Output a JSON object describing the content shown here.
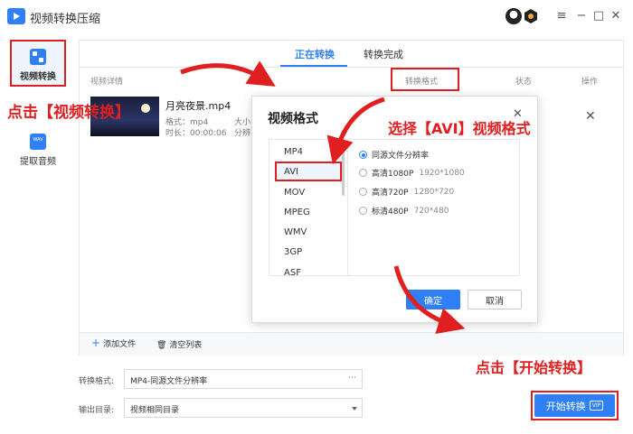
{
  "app": {
    "title": "视频转换压缩"
  },
  "window_controls": {
    "menu": "≡",
    "minimize": "−",
    "maximize": "□",
    "close": "✕"
  },
  "sidebar": {
    "items": [
      {
        "label": "视频转换",
        "icon": "video-convert-icon"
      },
      {
        "label": "提取音频",
        "icon": "extract-audio-icon"
      }
    ]
  },
  "tabs": [
    {
      "label": "正在转换"
    },
    {
      "label": "转换完成"
    }
  ],
  "columns": {
    "details": "视频详情",
    "format": "转换格式",
    "status": "状态",
    "action": "操作"
  },
  "file": {
    "name": "月亮夜景.mp4",
    "format_label": "格式：mp4",
    "duration_label": "时长：00:00:06",
    "size_label": "大小",
    "resolution_label": "分辨"
  },
  "bottom_bar": {
    "add_file": "添加文件",
    "clear_list": "清空列表"
  },
  "settings": {
    "format_label": "转换格式:",
    "format_value": "MP4-同源文件分辨率",
    "output_label": "输出目录:",
    "output_value": "视频相同目录"
  },
  "start_button": {
    "label": "开始转换",
    "badge": "VIP"
  },
  "dialog": {
    "title": "视频格式",
    "formats": [
      "MP4",
      "AVI",
      "MOV",
      "MPEG",
      "WMV",
      "3GP",
      "ASF"
    ],
    "selected_format": "AVI",
    "resolutions": [
      {
        "name": "同源文件分辨率",
        "dims": "",
        "selected": true
      },
      {
        "name": "高清1080P",
        "dims": "1920*1080",
        "selected": false
      },
      {
        "name": "高清720P",
        "dims": "1280*720",
        "selected": false
      },
      {
        "name": "标清480P",
        "dims": "720*480",
        "selected": false
      }
    ],
    "ok": "确定",
    "cancel": "取消"
  },
  "annotations": {
    "click_video_convert": "点击【视频转换】",
    "select_avi": "选择【AVI】视频格式",
    "click_start": "点击【开始转换】"
  },
  "colors": {
    "accent": "#2f7ff6",
    "annotation": "#e02020"
  }
}
